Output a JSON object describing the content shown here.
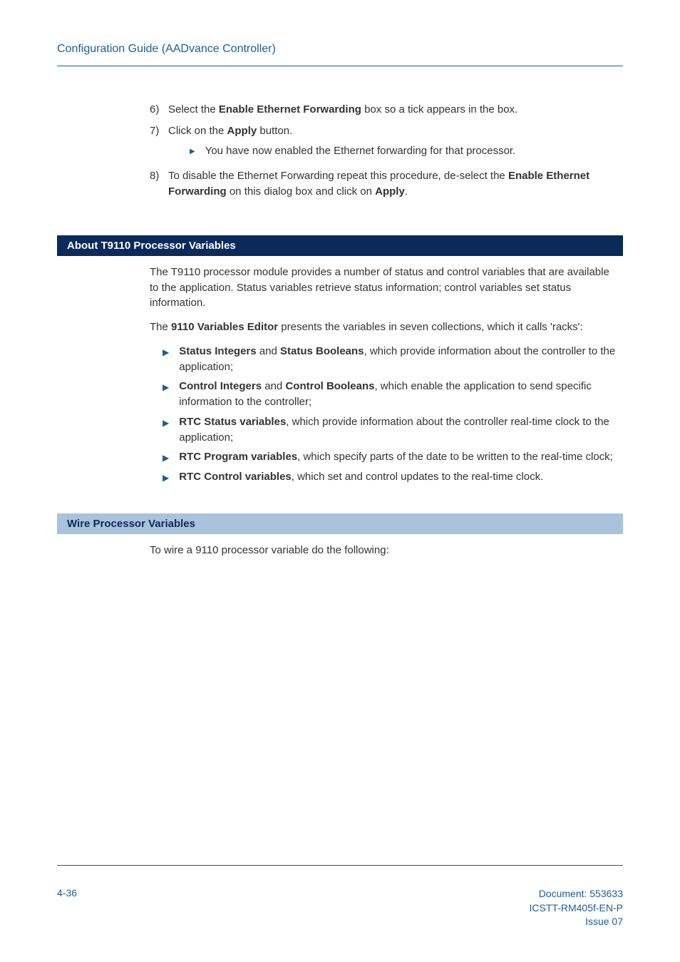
{
  "header": {
    "title": "Configuration Guide (AADvance Controller)"
  },
  "steps": {
    "s6_num": "6)",
    "s6_a": "Select the ",
    "s6_b": "Enable Ethernet Forwarding",
    "s6_c": " box so a tick appears in the box.",
    "s7_num": "7)",
    "s7_a": "Click on the ",
    "s7_b": "Apply",
    "s7_c": " button.",
    "s7_sub": "You have now enabled the Ethernet forwarding for that processor.",
    "s8_num": "8)",
    "s8_a": "To disable the Ethernet Forwarding repeat this procedure, de-select the ",
    "s8_b": "Enable Ethernet Forwarding",
    "s8_c": " on this dialog box and click on ",
    "s8_d": "Apply",
    "s8_e": "."
  },
  "section1": {
    "title": "About T9110 Processor Variables",
    "p1": "The T9110 processor module provides a number of status and control variables that are available to the application. Status variables retrieve status information; control variables set status information.",
    "p2_a": "The ",
    "p2_b": "9110 Variables Editor",
    "p2_c": " presents the variables in seven collections, which it calls 'racks':",
    "b1_a": "Status Integers",
    "b1_b": " and ",
    "b1_c": "Status Booleans",
    "b1_d": ", which provide information about the controller to the application;",
    "b2_a": "Control Integers",
    "b2_b": " and ",
    "b2_c": "Control Booleans",
    "b2_d": ", which enable the application to send specific information to the controller;",
    "b3_a": "RTC Status variables",
    "b3_b": ", which provide information about the controller real-time clock to the application;",
    "b4_a": "RTC Program variables",
    "b4_b": ", which specify parts of the date to be written to the real-time clock;",
    "b5_a": "RTC Control variables",
    "b5_b": ", which set and control updates to the real-time clock."
  },
  "section2": {
    "title": "Wire Processor Variables",
    "p1": "To wire a 9110 processor variable do the following:"
  },
  "footer": {
    "page": "4-36",
    "doc": "Document: 553633",
    "code": "ICSTT-RM405f-EN-P",
    "issue": "Issue 07"
  }
}
